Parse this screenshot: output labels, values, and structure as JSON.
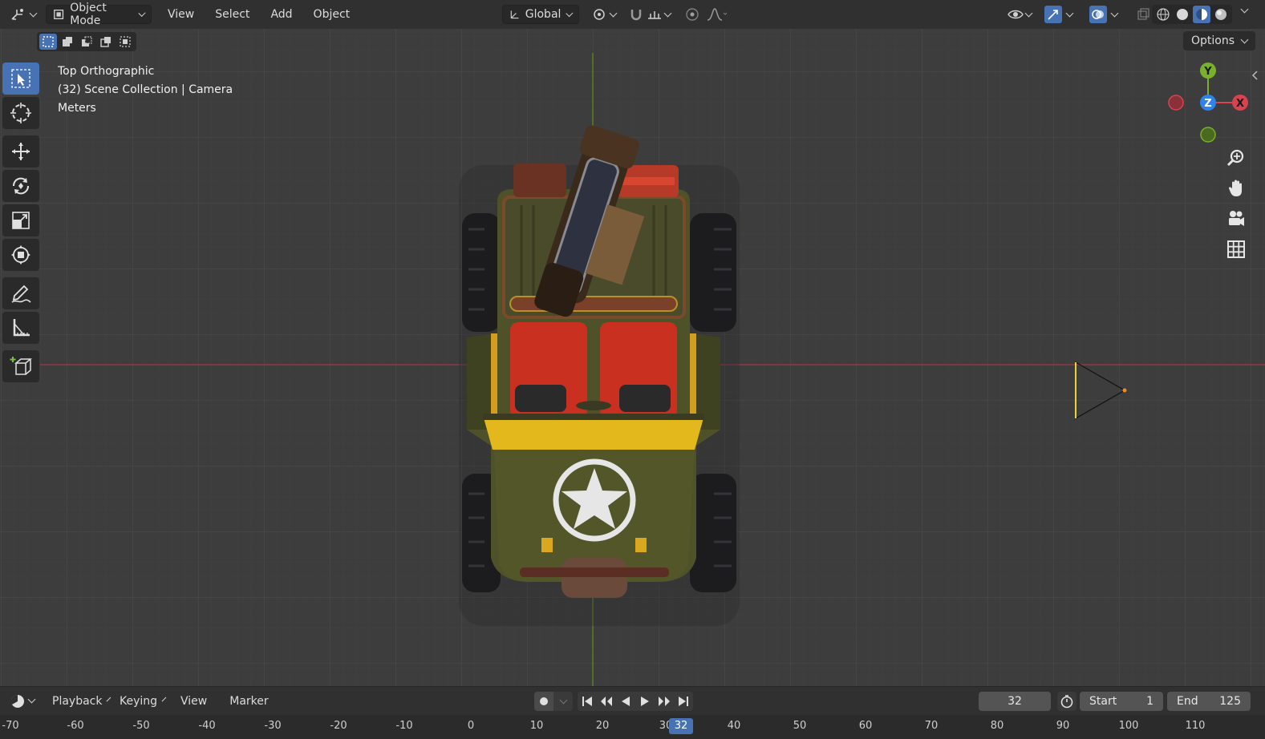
{
  "header": {
    "mode_label": "Object Mode",
    "menus": [
      "View",
      "Select",
      "Add",
      "Object"
    ],
    "orientation_label": "Global"
  },
  "viewport": {
    "view_name": "Top Orthographic",
    "collection_info": "(32) Scene Collection | Camera",
    "units": "Meters",
    "options_label": "Options",
    "gizmo": {
      "y": "Y",
      "x": "X",
      "z": "Z"
    },
    "colors": {
      "x_axis": "#d9434f",
      "y_axis": "#79b02c",
      "z_axis": "#2e84e8",
      "active": "#4772b3"
    }
  },
  "timeline": {
    "menus": [
      "Playback",
      "Keying",
      "View",
      "Marker"
    ],
    "current_frame": "32",
    "start_label": "Start",
    "start_value": "1",
    "end_label": "End",
    "end_value": "125",
    "ruler_ticks": [
      "-70",
      "-60",
      "-50",
      "-40",
      "-30",
      "-20",
      "-10",
      "0",
      "10",
      "20",
      "30",
      "40",
      "50",
      "60",
      "70",
      "80",
      "90",
      "100",
      "110"
    ],
    "ruler_cursor": "32"
  }
}
